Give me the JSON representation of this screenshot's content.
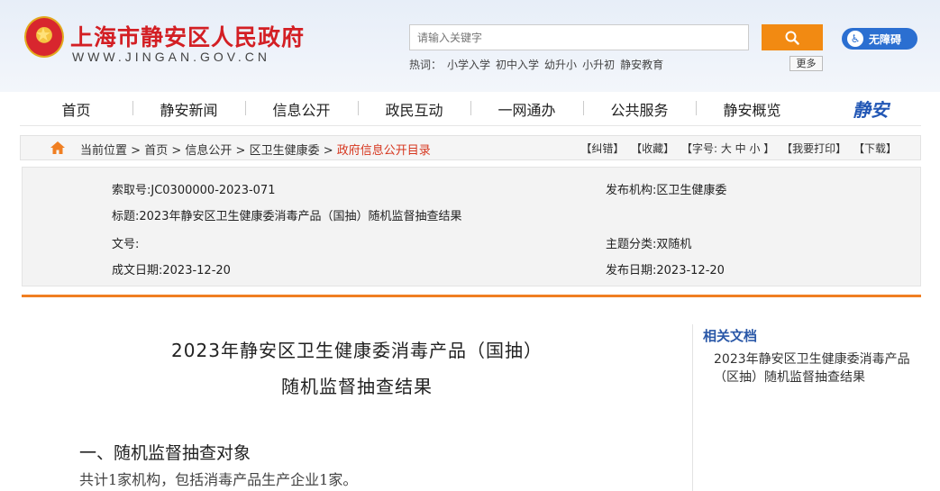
{
  "header": {
    "site_title": "上海市静安区人民政府",
    "site_domain": "WWW.JINGAN.GOV.CN",
    "search_placeholder": "请输入关键字",
    "hot_label": "热词：",
    "hot_words": [
      "小学入学",
      "初中入学",
      "幼升小",
      "小升初",
      "静安教育"
    ],
    "more_label": "更多",
    "accessibility_label": "无障碍"
  },
  "nav": {
    "items": [
      "首页",
      "静安新闻",
      "信息公开",
      "政民互动",
      "一网通办",
      "公共服务",
      "静安概览"
    ],
    "logo_text": "静安"
  },
  "breadcrumb": {
    "prefix": "当前位置",
    "path": [
      "首页",
      "信息公开",
      "区卫生健康委"
    ],
    "current": "政府信息公开目录",
    "tools": [
      "【纠错】",
      "【收藏】",
      "【字号: 大 中 小 】",
      "【我要打印】",
      "【下载】"
    ]
  },
  "info": {
    "index_no": "索取号:JC0300000-2023-071",
    "publisher": "发布机构:区卫生健康委",
    "title": "标题:2023年静安区卫生健康委消毒产品（国抽）随机监督抽查结果",
    "doc_no": "文号:",
    "category": "主题分类:双随机",
    "written_date": "成文日期:2023-12-20",
    "publish_date": "发布日期:2023-12-20"
  },
  "article": {
    "title_line1": "2023年静安区卫生健康委消毒产品（国抽）",
    "title_line2": "随机监督抽查结果",
    "section1_heading": "一、随机监督抽查对象",
    "section1_text": "共计1家机构，包括消毒产品生产企业1家。"
  },
  "sidebar": {
    "heading": "相关文档",
    "link1": "2023年静安区卫生健康委消毒产品（区抽）随机监督抽查结果"
  },
  "colors": {
    "brand_red": "#d31f24",
    "search_orange": "#f28a12",
    "accent_orange_line": "#f07f22",
    "sidebar_blue": "#2a58a8"
  }
}
